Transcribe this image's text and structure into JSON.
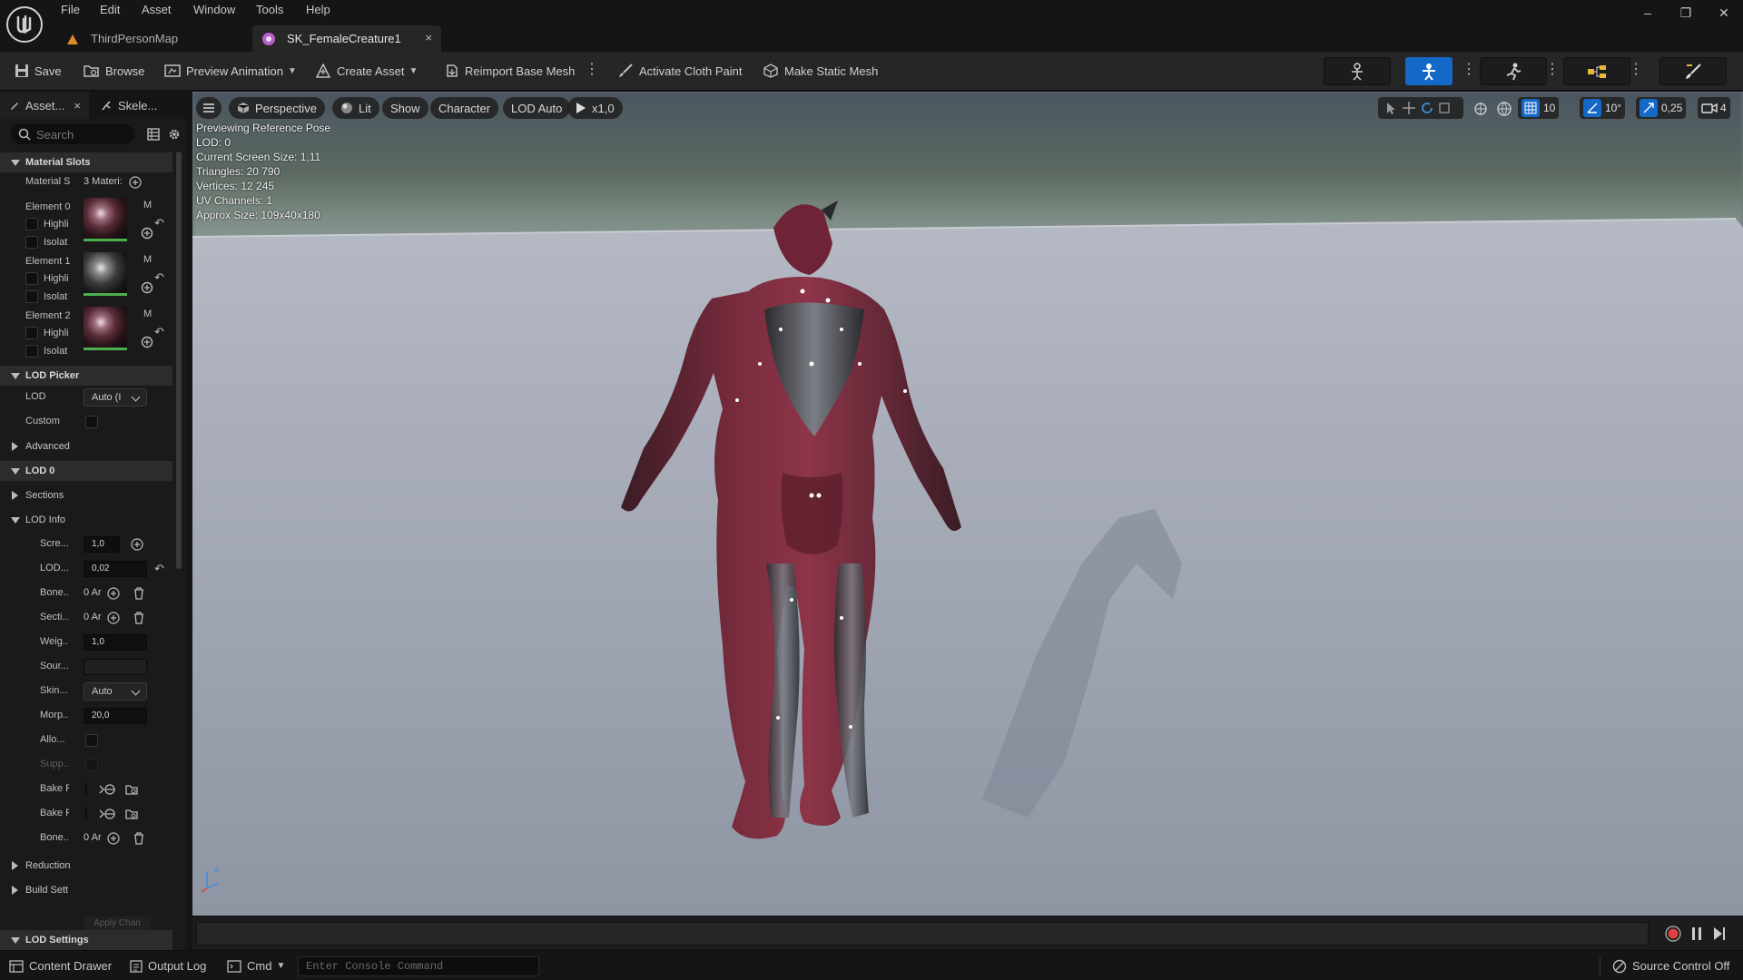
{
  "menu": [
    "File",
    "Edit",
    "Asset",
    "Window",
    "Tools",
    "Help"
  ],
  "tabs": {
    "map": {
      "label": "ThirdPersonMap"
    },
    "asset": {
      "label": "SK_FemaleCreature1",
      "close": "×"
    }
  },
  "window_controls": {
    "minimize": "–",
    "restore": "❐",
    "close": "✕"
  },
  "toolbar": {
    "save": "Save",
    "browse": "Browse",
    "preview_animation": "Preview Animation",
    "create_asset": "Create Asset",
    "reimport": "Reimport Base Mesh",
    "cloth_paint": "Activate Cloth Paint",
    "static_mesh": "Make Static Mesh"
  },
  "panel": {
    "tab_asset": "Asset...",
    "tab_close": "×",
    "tab_skeleton": "Skele...",
    "search_placeholder": "Search",
    "material_slots": {
      "header": "Material Slots",
      "slots_label": "Material S",
      "slots_value": "3 Materi:",
      "elements": [
        {
          "label": "Element 0",
          "highlight": "Highli",
          "isolate": "Isolat",
          "name": "M"
        },
        {
          "label": "Element 1",
          "highlight": "Highli",
          "isolate": "Isolat",
          "name": "M"
        },
        {
          "label": "Element 2",
          "highlight": "Highli",
          "isolate": "Isolat",
          "name": "M"
        }
      ]
    },
    "lod_picker": {
      "header": "LOD Picker",
      "lod_label": "LOD",
      "lod_value": "Auto (I",
      "custom_label": "Custom",
      "advanced": "Advanced"
    },
    "lod0": {
      "header": "LOD 0",
      "sections": "Sections",
      "lod_info": "LOD Info",
      "rows": {
        "screen_label": "Scre...",
        "screen_value": "1,0",
        "lod_label": "LOD...",
        "lod_value": "0,02",
        "bones_label": "Bone...",
        "bones_value": "0 Ar",
        "sections_label": "Secti...",
        "sections_value": "0 Ar",
        "weight_label": "Weig...",
        "weight_value": "1,0",
        "source_label": "Sour...",
        "skin_label": "Skin...",
        "skin_value": "Auto",
        "morph_label": "Morp...",
        "morph_value": "20,0",
        "allow_label": "Allo...",
        "support_label": "Supp...",
        "bake1_label": "Bake P",
        "bake2_label": "Bake P",
        "bones2_label": "Bone...",
        "bones2_value": "0 Ar"
      },
      "reduction": "Reduction",
      "build_settings": "Build Sett",
      "apply_changes": "Apply Chan"
    },
    "lod_settings": "LOD Settings"
  },
  "viewport": {
    "perspective": "Perspective",
    "lit": "Lit",
    "show": "Show",
    "character": "Character",
    "lod_auto": "LOD Auto",
    "speed": "x1,0",
    "grid_snap": "10",
    "rotation_snap": "10°",
    "scale_snap": "0,25",
    "camera_speed": "4",
    "info": [
      "Previewing Reference Pose",
      "LOD: 0",
      "Current Screen Size: 1,11",
      "Triangles: 20 790",
      "Vertices: 12 245",
      "UV Channels: 1",
      "Approx Size: 109x40x180"
    ]
  },
  "statusbar": {
    "content_drawer": "Content Drawer",
    "output_log": "Output Log",
    "cmd": "Cmd",
    "console_placeholder": "Enter Console Command",
    "source_control": "Source Control Off"
  },
  "colors": {
    "accent": "#1468c8",
    "material_ok": "#4caf50",
    "record": "#e04040"
  }
}
